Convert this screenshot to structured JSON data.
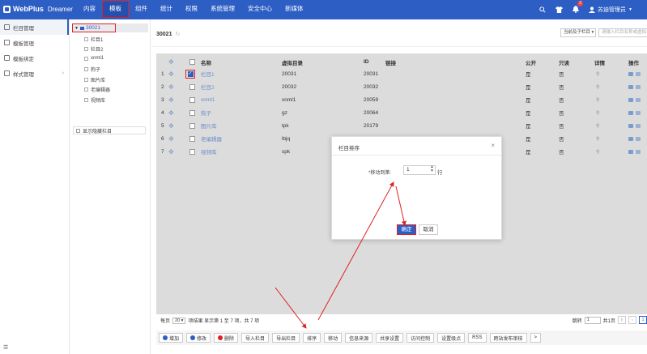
{
  "app": {
    "brand": "WebPlus",
    "brand_sub": "Dreamer"
  },
  "nav": [
    "内容",
    "模板",
    "组件",
    "统计",
    "权限",
    "系统管理",
    "安全中心",
    "新媒体"
  ],
  "topbar": {
    "badge": "2",
    "user": "苏迪管理员"
  },
  "sidebar": {
    "items": [
      {
        "label": "栏目管理"
      },
      {
        "label": "模板管理"
      },
      {
        "label": "模板绑定"
      },
      {
        "label": "样式管理"
      }
    ],
    "bottom_icon": "☰"
  },
  "tree": {
    "root": "30021",
    "items": [
      "栏目1",
      "栏目2",
      "xnml1",
      "狗子",
      "图片库",
      "老编辑器",
      "视频库"
    ],
    "show_hidden": "显示隐藏栏目"
  },
  "main": {
    "title": "30021",
    "scope": "当前及子栏目",
    "search_placeholder": "请输入栏目名称或虚拟目录"
  },
  "table": {
    "headers": {
      "name": "名称",
      "dir": "虚拟目录",
      "id": "ID",
      "link": "链接",
      "public": "公开",
      "readonly": "只读",
      "detail": "详情",
      "ops": "操作"
    },
    "rows": [
      {
        "idx": "1",
        "name": "栏目1",
        "dir": "20031",
        "id": "20031",
        "public": "是",
        "readonly": "否"
      },
      {
        "idx": "2",
        "name": "栏目2",
        "dir": "20032",
        "id": "20032",
        "public": "是",
        "readonly": "否"
      },
      {
        "idx": "3",
        "name": "xnml1",
        "dir": "xnml1",
        "id": "20059",
        "public": "是",
        "readonly": "否"
      },
      {
        "idx": "4",
        "name": "狗子",
        "dir": "gz",
        "id": "20064",
        "public": "是",
        "readonly": "否"
      },
      {
        "idx": "5",
        "name": "图片库",
        "dir": "tpk",
        "id": "20179",
        "public": "是",
        "readonly": "否"
      },
      {
        "idx": "6",
        "name": "老编辑器",
        "dir": "lbjq",
        "id": "",
        "public": "是",
        "readonly": "否"
      },
      {
        "idx": "7",
        "name": "视频库",
        "dir": "spk",
        "id": "",
        "public": "是",
        "readonly": "否"
      }
    ]
  },
  "pager": {
    "per_page_label": "每页",
    "per_page": "20",
    "summary": "项结果 显示第 1 至 7 项，共 7 项",
    "jump_label": "跳转",
    "jump_value": "1",
    "total_pages": "共1页",
    "first": "|‹",
    "prev": "‹",
    "current": "1"
  },
  "toolbar": [
    "增加",
    "修改",
    "删除",
    "导入栏目",
    "导出栏目",
    "排序",
    "移动",
    "信息来源",
    "共享设置",
    "访问控制",
    "设置级点",
    "RSS",
    "跨站发布审核",
    ">"
  ],
  "modal": {
    "title": "栏目排序",
    "close": "×",
    "label": "*移动到第:",
    "value": "1",
    "spin_up": "▲",
    "spin_down": "▼",
    "unit": "行",
    "ok": "确定",
    "cancel": "取消"
  },
  "colors": {
    "primary": "#2d5ec4",
    "highlight": "#e02020",
    "link": "#6b8ec7"
  }
}
